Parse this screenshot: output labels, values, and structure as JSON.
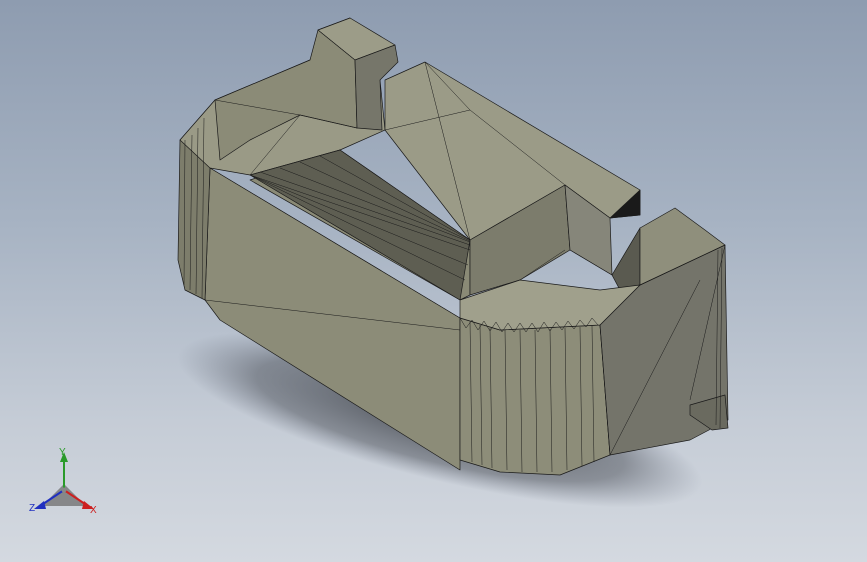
{
  "viewport": {
    "background_top": "#8e9cb0",
    "background_bottom": "#d4d9e0",
    "model_color": "#8a8a76",
    "edge_color": "#1a1a1a"
  },
  "triad": {
    "x_label": "X",
    "y_label": "Y",
    "z_label": "Z",
    "x_color": "#cc2020",
    "y_color": "#2a9a2a",
    "z_color": "#2030c0"
  }
}
